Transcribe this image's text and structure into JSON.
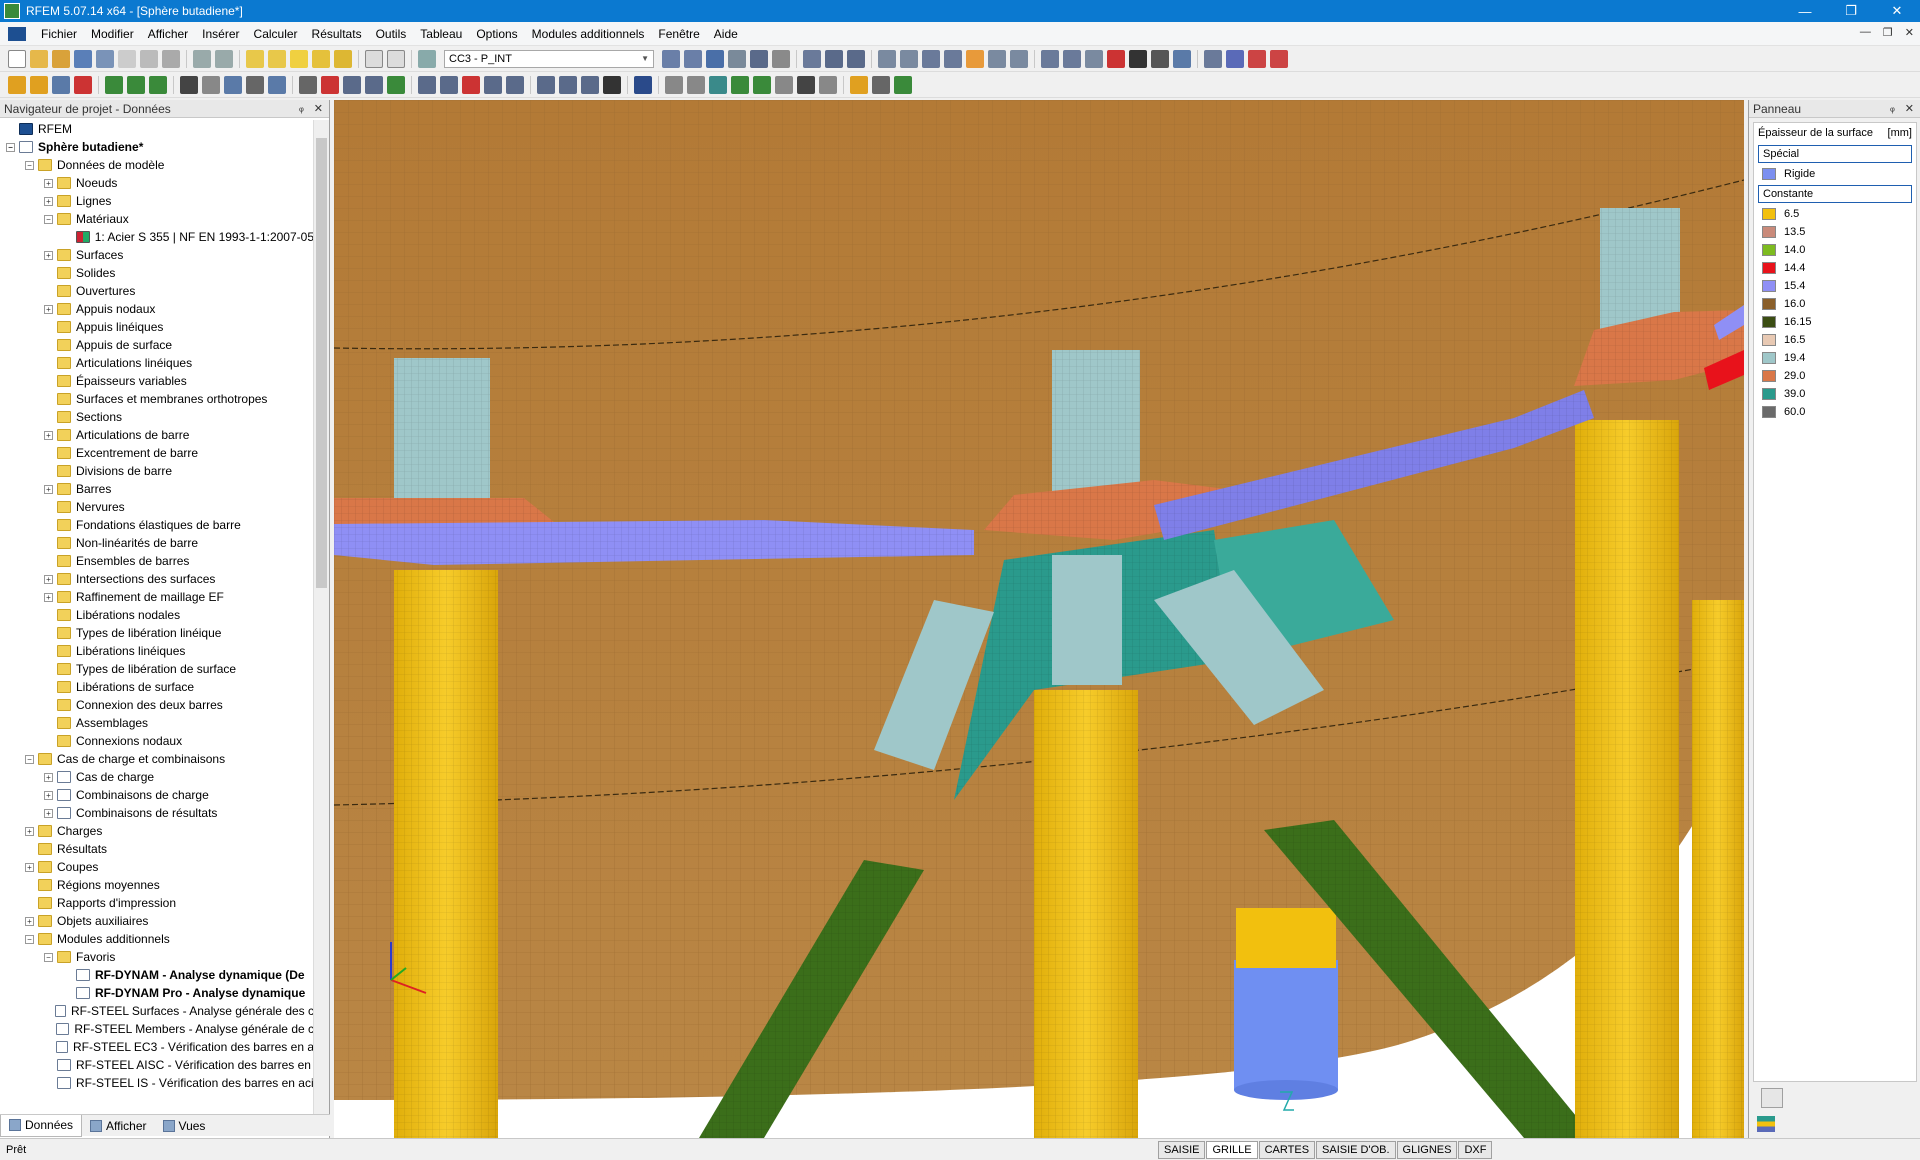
{
  "window": {
    "title": "RFEM 5.07.14 x64 - [Sphère butadiene*]",
    "minimize": "—",
    "maximize": "❐",
    "close": "✕"
  },
  "menu": {
    "items": [
      "Fichier",
      "Modifier",
      "Afficher",
      "Insérer",
      "Calculer",
      "Résultats",
      "Outils",
      "Tableau",
      "Options",
      "Modules additionnels",
      "Fenêtre",
      "Aide"
    ],
    "mdi": [
      "—",
      "❐",
      "✕"
    ]
  },
  "toolbar": {
    "load_case": "CC3 - P_INT"
  },
  "navigator": {
    "header": "Navigateur de projet - Données",
    "pin": "ᵩ",
    "close": "✕",
    "tree": [
      {
        "label": "RFEM",
        "level": 0,
        "exp": "",
        "icon": "root",
        "bold": false
      },
      {
        "label": "Sphère butadiene*",
        "level": 0,
        "exp": "−",
        "icon": "doc",
        "bold": true
      },
      {
        "label": "Données de modèle",
        "level": 1,
        "exp": "−",
        "icon": "folder",
        "bold": false
      },
      {
        "label": "Noeuds",
        "level": 2,
        "exp": "+",
        "icon": "folder",
        "bold": false
      },
      {
        "label": "Lignes",
        "level": 2,
        "exp": "+",
        "icon": "folder",
        "bold": false
      },
      {
        "label": "Matériaux",
        "level": 2,
        "exp": "−",
        "icon": "folder",
        "bold": false
      },
      {
        "label": "1: Acier S 355 | NF EN 1993-1-1:2007-05",
        "level": 3,
        "exp": "",
        "icon": "mat",
        "bold": false
      },
      {
        "label": "Surfaces",
        "level": 2,
        "exp": "+",
        "icon": "folder",
        "bold": false
      },
      {
        "label": "Solides",
        "level": 2,
        "exp": "",
        "icon": "folder",
        "bold": false
      },
      {
        "label": "Ouvertures",
        "level": 2,
        "exp": "",
        "icon": "folder",
        "bold": false
      },
      {
        "label": "Appuis nodaux",
        "level": 2,
        "exp": "+",
        "icon": "folder",
        "bold": false
      },
      {
        "label": "Appuis linéiques",
        "level": 2,
        "exp": "",
        "icon": "folder",
        "bold": false
      },
      {
        "label": "Appuis de surface",
        "level": 2,
        "exp": "",
        "icon": "folder",
        "bold": false
      },
      {
        "label": "Articulations linéiques",
        "level": 2,
        "exp": "",
        "icon": "folder",
        "bold": false
      },
      {
        "label": "Épaisseurs variables",
        "level": 2,
        "exp": "",
        "icon": "folder",
        "bold": false
      },
      {
        "label": "Surfaces et membranes orthotropes",
        "level": 2,
        "exp": "",
        "icon": "folder",
        "bold": false
      },
      {
        "label": "Sections",
        "level": 2,
        "exp": "",
        "icon": "folder",
        "bold": false
      },
      {
        "label": "Articulations de barre",
        "level": 2,
        "exp": "+",
        "icon": "folder",
        "bold": false
      },
      {
        "label": "Excentrement de barre",
        "level": 2,
        "exp": "",
        "icon": "folder",
        "bold": false
      },
      {
        "label": "Divisions de barre",
        "level": 2,
        "exp": "",
        "icon": "folder",
        "bold": false
      },
      {
        "label": "Barres",
        "level": 2,
        "exp": "+",
        "icon": "folder",
        "bold": false
      },
      {
        "label": "Nervures",
        "level": 2,
        "exp": "",
        "icon": "folder",
        "bold": false
      },
      {
        "label": "Fondations élastiques de barre",
        "level": 2,
        "exp": "",
        "icon": "folder",
        "bold": false
      },
      {
        "label": "Non-linéarités de barre",
        "level": 2,
        "exp": "",
        "icon": "folder",
        "bold": false
      },
      {
        "label": "Ensembles de barres",
        "level": 2,
        "exp": "",
        "icon": "folder",
        "bold": false
      },
      {
        "label": "Intersections des surfaces",
        "level": 2,
        "exp": "+",
        "icon": "folder",
        "bold": false
      },
      {
        "label": "Raffinement de maillage EF",
        "level": 2,
        "exp": "+",
        "icon": "folder",
        "bold": false
      },
      {
        "label": "Libérations nodales",
        "level": 2,
        "exp": "",
        "icon": "folder",
        "bold": false
      },
      {
        "label": "Types de libération linéique",
        "level": 2,
        "exp": "",
        "icon": "folder",
        "bold": false
      },
      {
        "label": "Libérations linéiques",
        "level": 2,
        "exp": "",
        "icon": "folder",
        "bold": false
      },
      {
        "label": "Types de libération de surface",
        "level": 2,
        "exp": "",
        "icon": "folder",
        "bold": false
      },
      {
        "label": "Libérations de surface",
        "level": 2,
        "exp": "",
        "icon": "folder",
        "bold": false
      },
      {
        "label": "Connexion des deux barres",
        "level": 2,
        "exp": "",
        "icon": "folder",
        "bold": false
      },
      {
        "label": "Assemblages",
        "level": 2,
        "exp": "",
        "icon": "folder",
        "bold": false
      },
      {
        "label": "Connexions nodaux",
        "level": 2,
        "exp": "",
        "icon": "folder",
        "bold": false
      },
      {
        "label": "Cas de charge et combinaisons",
        "level": 1,
        "exp": "−",
        "icon": "folder",
        "bold": false
      },
      {
        "label": "Cas de charge",
        "level": 2,
        "exp": "+",
        "icon": "doc",
        "bold": false
      },
      {
        "label": "Combinaisons de charge",
        "level": 2,
        "exp": "+",
        "icon": "doc",
        "bold": false
      },
      {
        "label": "Combinaisons de résultats",
        "level": 2,
        "exp": "+",
        "icon": "doc",
        "bold": false
      },
      {
        "label": "Charges",
        "level": 1,
        "exp": "+",
        "icon": "folder",
        "bold": false
      },
      {
        "label": "Résultats",
        "level": 1,
        "exp": "",
        "icon": "folder",
        "bold": false
      },
      {
        "label": "Coupes",
        "level": 1,
        "exp": "+",
        "icon": "folder",
        "bold": false
      },
      {
        "label": "Régions moyennes",
        "level": 1,
        "exp": "",
        "icon": "folder",
        "bold": false
      },
      {
        "label": "Rapports d'impression",
        "level": 1,
        "exp": "",
        "icon": "folder",
        "bold": false
      },
      {
        "label": "Objets auxiliaires",
        "level": 1,
        "exp": "+",
        "icon": "folder",
        "bold": false
      },
      {
        "label": "Modules additionnels",
        "level": 1,
        "exp": "−",
        "icon": "folder",
        "bold": false
      },
      {
        "label": "Favoris",
        "level": 2,
        "exp": "−",
        "icon": "folder",
        "bold": false
      },
      {
        "label": "RF-DYNAM - Analyse dynamique (De",
        "level": 3,
        "exp": "",
        "icon": "doc",
        "bold": true
      },
      {
        "label": "RF-DYNAM Pro - Analyse dynamique",
        "level": 3,
        "exp": "",
        "icon": "doc",
        "bold": true
      },
      {
        "label": "RF-STEEL Surfaces - Analyse générale des c",
        "level": 2,
        "exp": "",
        "icon": "doc",
        "bold": false
      },
      {
        "label": "RF-STEEL Members - Analyse générale de c",
        "level": 2,
        "exp": "",
        "icon": "doc",
        "bold": false
      },
      {
        "label": "RF-STEEL EC3 - Vérification des barres en a",
        "level": 2,
        "exp": "",
        "icon": "doc",
        "bold": false
      },
      {
        "label": "RF-STEEL AISC - Vérification des barres en",
        "level": 2,
        "exp": "",
        "icon": "doc",
        "bold": false
      },
      {
        "label": "RF-STEEL IS - Vérification des barres en aci",
        "level": 2,
        "exp": "",
        "icon": "doc",
        "bold": false
      }
    ],
    "tabs": [
      "Données",
      "Afficher",
      "Vues"
    ]
  },
  "panel": {
    "header": "Panneau",
    "pin": "ᵩ",
    "close": "✕",
    "legend_title": "Épaisseur de la surface",
    "legend_unit": "[mm]",
    "group_special": "Spécial",
    "special_items": [
      {
        "label": "Rigide",
        "color": "#7b8ff0"
      }
    ],
    "group_constant": "Constante",
    "constant_items": [
      {
        "label": "6.5",
        "color": "#f2c00e"
      },
      {
        "label": "13.5",
        "color": "#c98a7a"
      },
      {
        "label": "14.0",
        "color": "#7dbb1f"
      },
      {
        "label": "14.4",
        "color": "#e8121b"
      },
      {
        "label": "15.4",
        "color": "#8f8ff5"
      },
      {
        "label": "16.0",
        "color": "#8a5f2a"
      },
      {
        "label": "16.15",
        "color": "#3b4d13"
      },
      {
        "label": "16.5",
        "color": "#e8c9b3"
      },
      {
        "label": "19.4",
        "color": "#9fc7c9"
      },
      {
        "label": "29.0",
        "color": "#d97748"
      },
      {
        "label": "39.0",
        "color": "#2a9a8c"
      },
      {
        "label": "60.0",
        "color": "#6a6a6a"
      }
    ]
  },
  "status": {
    "text": "Prêt",
    "buttons": [
      "SAISIE",
      "GRILLE",
      "CARTES",
      "SAISIE D'OB.",
      "GLIGNES",
      "DXF"
    ]
  },
  "model_colors": {
    "sphere": "#b5803e",
    "column": "#f2c00e",
    "ring_beam": "#8f8ff5",
    "brace": "#3b6e1a",
    "sleeve": "#9fc7c9",
    "plate": "#d97748",
    "gusset": "#2a9a8c"
  }
}
